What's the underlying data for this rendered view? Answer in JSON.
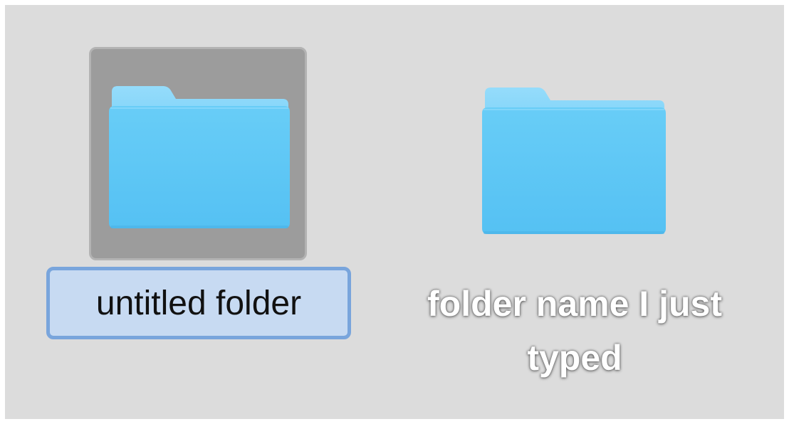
{
  "desktop": {
    "background_color": "#dcdcdc"
  },
  "items": [
    {
      "name": "untitled folder",
      "icon": "folder-icon",
      "state": "selected-renaming"
    },
    {
      "name_lines": [
        "folder name I just",
        "typed"
      ],
      "icon": "folder-icon",
      "state": "normal"
    }
  ],
  "colors": {
    "folder_body": "#5cc7f5",
    "folder_tab": "#88d7fa",
    "selection_fill": "#9c9c9c",
    "rename_border": "#79a5dc",
    "rename_fill": "#c7daf2"
  }
}
